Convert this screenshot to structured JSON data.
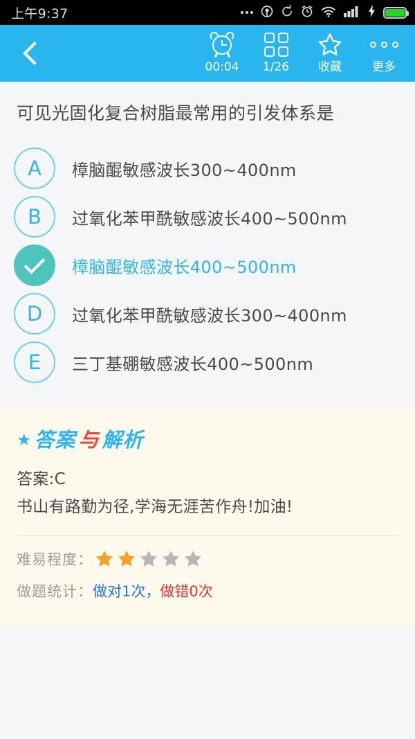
{
  "statusbar": {
    "time": "上午9:37",
    "icons": [
      "more-dots",
      "location",
      "sync",
      "alarm",
      "wifi",
      "signal",
      "charging",
      "battery"
    ]
  },
  "appbar": {
    "back_icon": "chevron-left-icon",
    "actions": [
      {
        "icon": "alarm-clock-icon",
        "label": "00:04",
        "name": "timer"
      },
      {
        "icon": "grid-icon",
        "label": "1/26",
        "name": "question-index"
      },
      {
        "icon": "star-outline-icon",
        "label": "收藏",
        "name": "favorite"
      },
      {
        "icon": "more-dots-icon",
        "label": "更多",
        "name": "more"
      }
    ]
  },
  "question": {
    "text": "可见光固化复合树脂最常用的引发体系是",
    "options": [
      {
        "letter": "A",
        "text": "樟脑醌敏感波长300~400nm",
        "selected": false
      },
      {
        "letter": "B",
        "text": "过氧化苯甲酰敏感波长400~500nm",
        "selected": false
      },
      {
        "letter": "C",
        "text": "樟脑醌敏感波长400~500nm",
        "selected": true
      },
      {
        "letter": "D",
        "text": "过氧化苯甲酰敏感波长300~400nm",
        "selected": false
      },
      {
        "letter": "E",
        "text": "三丁基硼敏感波长400~500nm",
        "selected": false
      }
    ]
  },
  "analysis": {
    "title_star": "★",
    "title_part1": "答案",
    "title_part2": "与",
    "title_part3": "解析",
    "answer_line": "答案:C",
    "encouragement": "书山有路勤为径,学海无涯苦作舟!加油!",
    "difficulty_label": "难易程度：",
    "difficulty_filled": 2,
    "difficulty_total": 5,
    "stats_label": "做题统计：",
    "stats_correct": "做对1次",
    "stats_separator": "，",
    "stats_wrong": "做错0次"
  },
  "colors": {
    "accent_blue": "#29b6ee",
    "option_blue": "#2fb4f0",
    "selected_teal": "#4ec4bd",
    "analysis_bg": "#fdfaed",
    "star_orange": "#f5a028",
    "star_gray": "#b6b6b6",
    "correct_blue": "#1f73e8",
    "wrong_red": "#e8312f",
    "title_red": "#f0413c"
  }
}
